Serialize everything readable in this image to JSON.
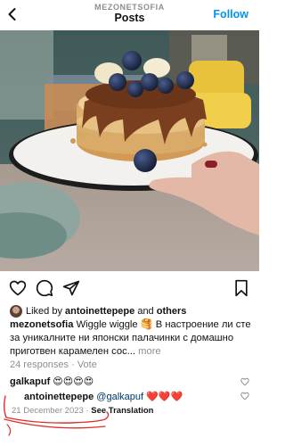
{
  "header": {
    "username": "MEZONETSOFIA",
    "title": "Posts",
    "follow_label": "Follow"
  },
  "post": {
    "liked_by_prefix": "Liked by ",
    "liked_by_user": "antoinettepepe",
    "liked_by_suffix": " and ",
    "liked_by_others": "others",
    "caption_user": "mezonetsofia",
    "caption_text": " Wiggle wiggle 🥞 В настроение ли сте за уникалните ни японски палачинки с домашно приготвен карамелен сос...",
    "more_label": " more",
    "responses": "24 responses · Vote",
    "comment1_user": "galkapuf",
    "comment1_text": " 😍😍😍😍",
    "comment2_user": "antoinettepepe",
    "comment2_mention": "@galkapuf",
    "comment2_text": " ❤️❤️❤️",
    "date": "21 December 2023",
    "dot": " · ",
    "see_translation": "See Translation"
  },
  "colors": {
    "accent": "#0095f6",
    "annotation": "#e0302a"
  },
  "icons": [
    "back-icon",
    "heart-icon",
    "comment-icon",
    "share-icon",
    "bookmark-icon",
    "user-tag-icon",
    "mute-icon"
  ]
}
